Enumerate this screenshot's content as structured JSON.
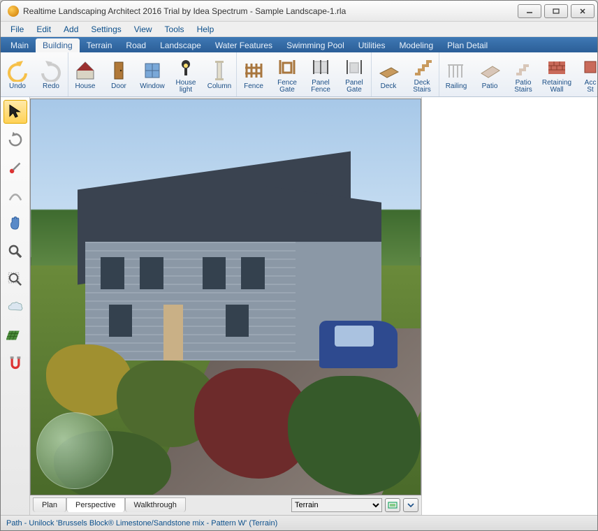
{
  "window": {
    "title": "Realtime Landscaping Architect 2016 Trial by Idea Spectrum - Sample Landscape-1.rla"
  },
  "menu": {
    "items": [
      "File",
      "Edit",
      "Add",
      "Settings",
      "View",
      "Tools",
      "Help"
    ]
  },
  "tabs": {
    "items": [
      "Main",
      "Building",
      "Terrain",
      "Road",
      "Landscape",
      "Water Features",
      "Swimming Pool",
      "Utilities",
      "Modeling",
      "Plan Detail"
    ],
    "active_index": 1
  },
  "ribbon": {
    "groups": [
      {
        "items": [
          {
            "icon": "undo",
            "label": "Undo"
          },
          {
            "icon": "redo",
            "label": "Redo"
          }
        ]
      },
      {
        "items": [
          {
            "icon": "house",
            "label": "House"
          },
          {
            "icon": "door",
            "label": "Door"
          },
          {
            "icon": "window",
            "label": "Window"
          },
          {
            "icon": "houselight",
            "label": "House\nlight"
          },
          {
            "icon": "column",
            "label": "Column"
          }
        ]
      },
      {
        "items": [
          {
            "icon": "fence",
            "label": "Fence"
          },
          {
            "icon": "fencegate",
            "label": "Fence\nGate"
          },
          {
            "icon": "panelfence",
            "label": "Panel\nFence"
          },
          {
            "icon": "panelgate",
            "label": "Panel\nGate"
          }
        ]
      },
      {
        "items": [
          {
            "icon": "deck",
            "label": "Deck"
          },
          {
            "icon": "deckstairs",
            "label": "Deck\nStairs"
          }
        ]
      },
      {
        "items": [
          {
            "icon": "railing",
            "label": "Railing"
          },
          {
            "icon": "patio",
            "label": "Patio"
          },
          {
            "icon": "patiostairs",
            "label": "Patio\nStairs"
          },
          {
            "icon": "retwall",
            "label": "Retaining\nWall"
          },
          {
            "icon": "accessory",
            "label": "Acc\nSt"
          }
        ]
      }
    ]
  },
  "side_tools": [
    {
      "name": "select-tool",
      "selected": true
    },
    {
      "name": "rotate-tool"
    },
    {
      "name": "adjust-tool"
    },
    {
      "name": "curve-tool"
    },
    {
      "name": "pan-tool"
    },
    {
      "name": "zoom-tool"
    },
    {
      "name": "zoom-selection-tool"
    },
    {
      "name": "cloud-tool"
    },
    {
      "name": "grid-tool"
    },
    {
      "name": "snap-tool"
    }
  ],
  "view_tabs": {
    "items": [
      "Plan",
      "Perspective",
      "Walkthrough"
    ],
    "active_index": 1
  },
  "layer": {
    "selected": "Terrain"
  },
  "status": {
    "text": "Path - Unilock 'Brussels Block® Limestone/Sandstone mix - Pattern W' (Terrain)"
  }
}
